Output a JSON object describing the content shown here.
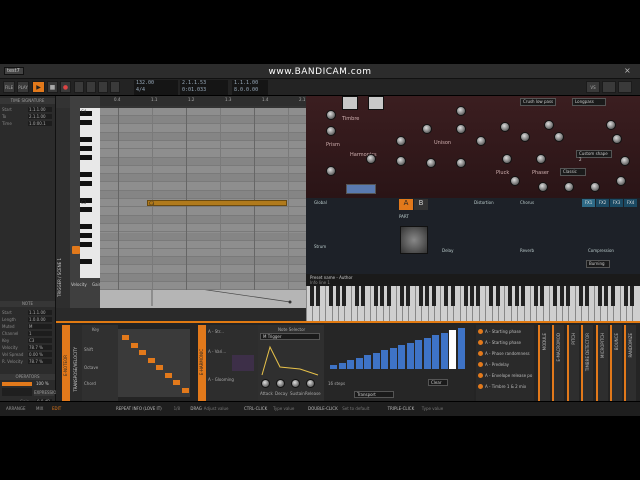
{
  "watermark": "www.BANDICAM.com",
  "app": {
    "tab_label": "test7",
    "tab_close": "×",
    "file_label": "FILE",
    "play_label": "PLAY",
    "rec_label": "REC"
  },
  "transport": {
    "tempo": "132.00",
    "signature": "4/4",
    "position": "2.1.1.53",
    "time": "0:01.033",
    "loop_start": "1.1.1.00",
    "loop_end": "8.0.0.00",
    "vs_label": "VS",
    "play_icon": "▶",
    "stop_icon": "■",
    "record_icon": "●"
  },
  "inspector": {
    "header": "TIME SIGNATURE",
    "rows": [
      {
        "label": "Start",
        "value": "1.1.1.00"
      },
      {
        "label": "To",
        "value": "2.1.1.00"
      },
      {
        "label": "Time",
        "value": "1.0:00.1"
      }
    ],
    "note_header": "NOTE",
    "note_rows": [
      {
        "label": "Start",
        "value": "1.1.1.00"
      },
      {
        "label": "Length",
        "value": "1.0.0.00"
      },
      {
        "label": "Muted",
        "value": "M"
      },
      {
        "label": "Channel",
        "value": "1"
      },
      {
        "label": "Key",
        "value": "C3"
      },
      {
        "label": "Velocity",
        "value": "78.7 %"
      },
      {
        "label": "Vel Spread",
        "value": "0.00 %"
      },
      {
        "label": "R. Velocity",
        "value": "78.7 %"
      }
    ],
    "operators_header": "OPERATORS",
    "chance_value": "100 %",
    "expressions_header": "EXPRESSIONS",
    "expr_rows": [
      {
        "label": "Gain",
        "value": "0.0 dB"
      },
      {
        "label": "Pan",
        "value": "0.00"
      },
      {
        "label": "Timbre",
        "value": "0.00"
      },
      {
        "label": "Pitch",
        "value": "0.00"
      },
      {
        "label": "Pressure",
        "value": "0.00"
      }
    ]
  },
  "roll": {
    "track_label": "TRIGGER / SCENE 1",
    "ruler": [
      "0.4",
      "1.1",
      "1.2",
      "1.3",
      "1.4",
      "2.1"
    ],
    "key_labels": [
      "C4",
      "C3"
    ],
    "note_label": "C3",
    "tool_labels": [
      "Velocity",
      "Gain"
    ],
    "panel_button_labels": [
      "Pan",
      "Timbre",
      "Pressure"
    ]
  },
  "synth": {
    "patch_sections": [
      "Timbre",
      "Harmonics",
      "Unison",
      "Prism",
      "Pluck",
      "Phaser"
    ],
    "pluck_select": "Crush low pass",
    "custom_shape": "Custom shape 2",
    "longpass": "Longpass",
    "classic": "Classic",
    "global_label": "Global",
    "distortion_label": "Distortion",
    "chorus_label": "Chorus",
    "delay_label": "Delay",
    "reverb_label": "Reverb",
    "compression_label": "Compression",
    "strum_label": "Strum",
    "part_label": "PART",
    "ab_a": "A",
    "ab_b": "B",
    "preset_label": "Preset name - Author",
    "preset_info": [
      "Info line 1",
      "Info line 2"
    ],
    "tabs": [
      "FX1",
      "FX2",
      "FX3",
      "FX4"
    ],
    "burning": "Burning"
  },
  "devices": {
    "d1_title": "E-NOTEOR",
    "d1_sub": "TRANSPOSE/VELOCITY",
    "key_label": "Key",
    "shift_label": "Shift",
    "octave_label": "Octave",
    "chord_label": "Chord",
    "d2_title": "E-HARMONIC",
    "d2_labels": [
      "A - Str...",
      "A - Vari...",
      "A - Glooming"
    ],
    "note_selector": "Note Selector",
    "trigger": "M Trigger",
    "adsr": [
      "Attack",
      "Decay",
      "Sustain",
      "Release"
    ],
    "steps": "16 steps",
    "clear": "Clear",
    "transport_sel": "Transport",
    "mod_items": [
      "A - Starting phase",
      "A - Starting phase",
      "A - Phase randomness",
      "A - Predelay",
      "A - Envelope release po",
      "A - Timbre 1 & 2 mix"
    ],
    "right_devices": [
      "MODULE",
      "E-MACROMOD",
      "PITCH",
      "TIMBRE DETECTOR",
      "MICROPITCH",
      "BOUNCE",
      "RANDOMIZE"
    ]
  },
  "statusbar": {
    "arrange": "ARRANGE",
    "mix": "MIX",
    "edit": "EDIT",
    "hints": [
      {
        "key": "REPEAT INFO (LOVE IT)",
        "val": "1/8"
      },
      {
        "key": "DRAG",
        "val": "Adjust value"
      },
      {
        "key": "CTRL-CLICK",
        "val": "Type value"
      },
      {
        "key": "DOUBLE-CLICK",
        "val": "Set to default"
      },
      {
        "key": "TRIPLE-CLICK",
        "val": "Type value"
      }
    ]
  },
  "colors": {
    "accent": "#e2791b",
    "synth_bg": "#2c1719",
    "roll_grid": "#8e8e8e",
    "note": "#b07a1c"
  }
}
